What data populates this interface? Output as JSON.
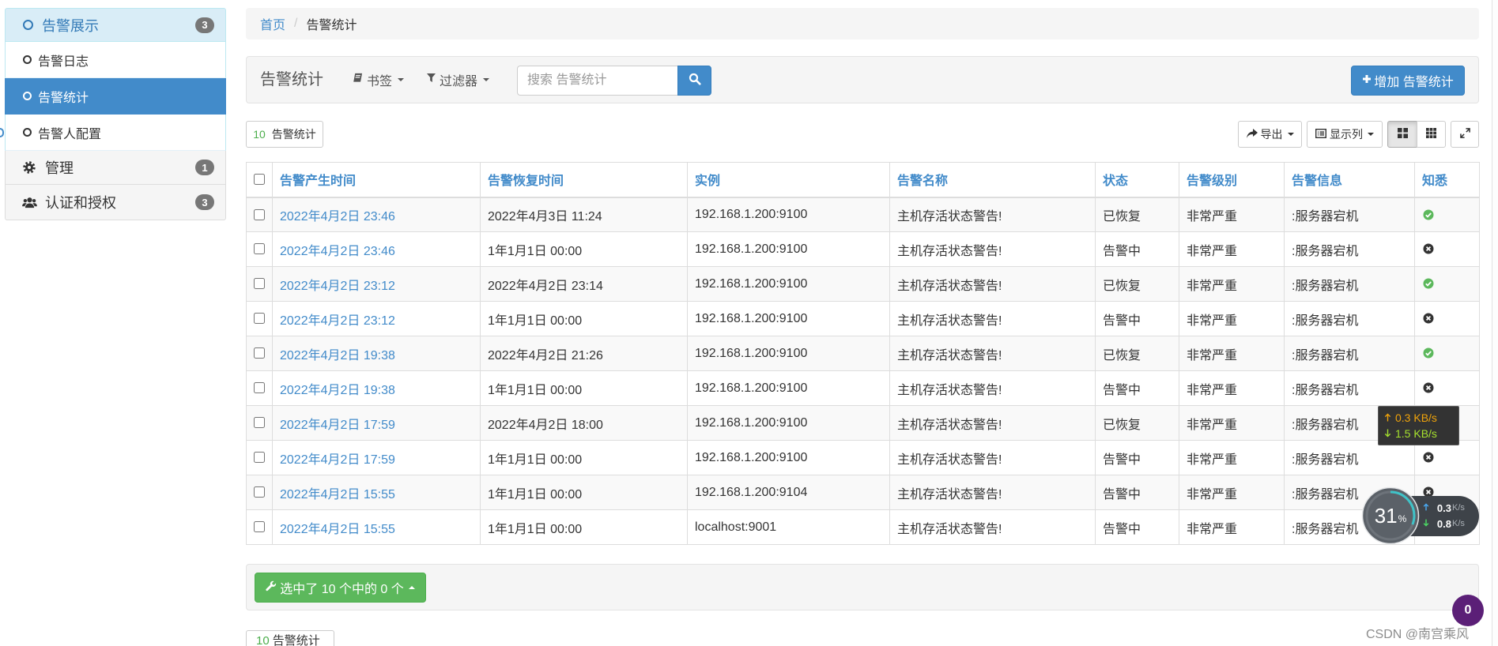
{
  "sidebar": {
    "groups": [
      {
        "label": "告警展示",
        "badge": "3",
        "icon": "circle-o-icon",
        "items": [
          {
            "label": "告警日志",
            "icon": "circle-o-icon",
            "active": false
          },
          {
            "label": "告警统计",
            "icon": "circle-o-icon",
            "active": true
          },
          {
            "label": "告警人配置",
            "icon": "circle-o-icon",
            "active": false
          }
        ]
      },
      {
        "label": "管理",
        "badge": "1",
        "icon": "gear-icon"
      },
      {
        "label": "认证和授权",
        "badge": "3",
        "icon": "users-icon"
      }
    ]
  },
  "breadcrumb": {
    "home": "首页",
    "separator": "/",
    "current": "告警统计"
  },
  "toolbar": {
    "title": "告警统计",
    "bookmarks_label": "书签",
    "filter_label": "过滤器",
    "search_placeholder": "搜索 告警统计",
    "add_label": "增加 告警统计"
  },
  "controls": {
    "count": "10",
    "count_label": "告警统计",
    "export_label": "导出",
    "columns_label": "显示列",
    "view_mode": "th-large-icon"
  },
  "table": {
    "select_all_checked": false,
    "headers": [
      "告警产生时间",
      "告警恢复时间",
      "实例",
      "告警名称",
      "状态",
      "告警级别",
      "告警信息",
      "知悉"
    ],
    "rows": [
      {
        "created": "2022年4月2日 23:46",
        "recovered": "2022年4月3日 11:24",
        "instance": "192.168.1.200:9100",
        "name": "主机存活状态警告!",
        "status": "已恢复",
        "level": "非常严重",
        "info": ":服务器宕机",
        "ack_icon": "check-circle-icon"
      },
      {
        "created": "2022年4月2日 23:46",
        "recovered": "1年1月1日 00:00",
        "instance": "192.168.1.200:9100",
        "name": "主机存活状态警告!",
        "status": "告警中",
        "level": "非常严重",
        "info": ":服务器宕机",
        "ack_icon": "times-circle-icon"
      },
      {
        "created": "2022年4月2日 23:12",
        "recovered": "2022年4月2日 23:14",
        "instance": "192.168.1.200:9100",
        "name": "主机存活状态警告!",
        "status": "已恢复",
        "level": "非常严重",
        "info": ":服务器宕机",
        "ack_icon": "check-circle-icon"
      },
      {
        "created": "2022年4月2日 23:12",
        "recovered": "1年1月1日 00:00",
        "instance": "192.168.1.200:9100",
        "name": "主机存活状态警告!",
        "status": "告警中",
        "level": "非常严重",
        "info": ":服务器宕机",
        "ack_icon": "times-circle-icon"
      },
      {
        "created": "2022年4月2日 19:38",
        "recovered": "2022年4月2日 21:26",
        "instance": "192.168.1.200:9100",
        "name": "主机存活状态警告!",
        "status": "已恢复",
        "level": "非常严重",
        "info": ":服务器宕机",
        "ack_icon": "check-circle-icon"
      },
      {
        "created": "2022年4月2日 19:38",
        "recovered": "1年1月1日 00:00",
        "instance": "192.168.1.200:9100",
        "name": "主机存活状态警告!",
        "status": "告警中",
        "level": "非常严重",
        "info": ":服务器宕机",
        "ack_icon": "times-circle-icon"
      },
      {
        "created": "2022年4月2日 17:59",
        "recovered": "2022年4月2日 18:00",
        "instance": "192.168.1.200:9100",
        "name": "主机存活状态警告!",
        "status": "已恢复",
        "level": "非常严重",
        "info": ":服务器宕机",
        "ack_icon": "check-circle-icon"
      },
      {
        "created": "2022年4月2日 17:59",
        "recovered": "1年1月1日 00:00",
        "instance": "192.168.1.200:9100",
        "name": "主机存活状态警告!",
        "status": "告警中",
        "level": "非常严重",
        "info": ":服务器宕机",
        "ack_icon": "times-circle-icon"
      },
      {
        "created": "2022年4月2日 15:55",
        "recovered": "1年1月1日 00:00",
        "instance": "192.168.1.200:9104",
        "name": "主机存活状态警告!",
        "status": "告警中",
        "level": "非常严重",
        "info": ":服务器宕机",
        "ack_icon": "times-circle-icon"
      },
      {
        "created": "2022年4月2日 15:55",
        "recovered": "1年1月1日 00:00",
        "instance": "localhost:9001",
        "name": "主机存活状态警告!",
        "status": "告警中",
        "level": "非常严重",
        "info": ":服务器宕机",
        "ack_icon": "times-circle-icon"
      }
    ]
  },
  "bulk_action": {
    "label": "选中了 10 个中的 0 个",
    "icon": "wrench-icon"
  },
  "footer": {
    "count": "10",
    "count_label": "告警统计"
  },
  "net_speed": {
    "up": "0.3 KB/s",
    "down": "1.5 KB/s",
    "up_color": "#f0a30a",
    "down_color": "#a6e22e"
  },
  "monitor": {
    "percent": "31",
    "percent_sign": "%",
    "up_value": "0.3",
    "up_unit": "K/s",
    "down_value": "0.8",
    "down_unit": "K/s"
  },
  "notification": {
    "count": "0"
  },
  "watermark": {
    "text": "CSDN @南宫乘风"
  },
  "colors": {
    "primary": "#428bca",
    "success": "#5cb85c",
    "badge": "#777777",
    "sidebar_group_bg": "#d9edf7",
    "notification": "#5b1f77",
    "gauge_arc": "#3fc3c8"
  }
}
